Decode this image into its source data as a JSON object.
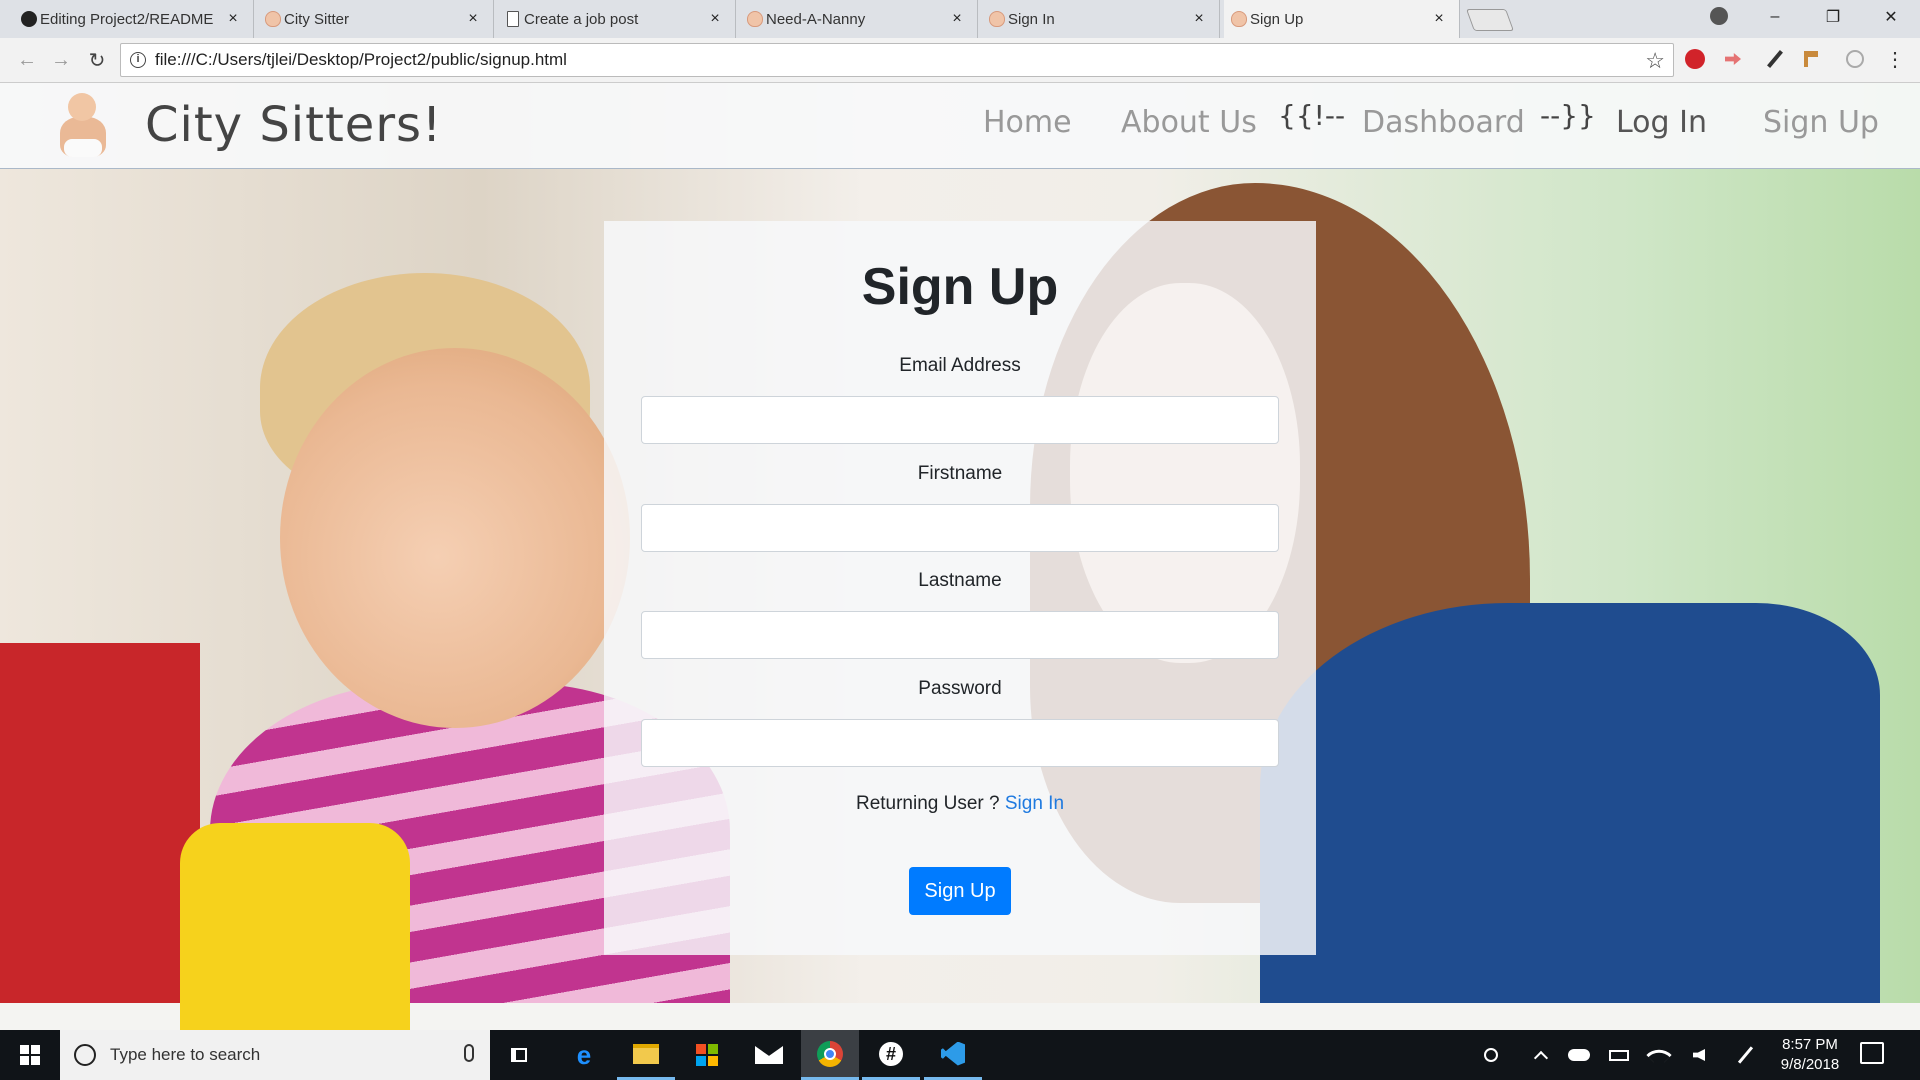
{
  "browser": {
    "tabs": [
      {
        "title": "Editing Project2/README",
        "favicon": "github-icon",
        "active": false
      },
      {
        "title": "City Sitter",
        "favicon": "baby-icon",
        "active": false
      },
      {
        "title": "Create a job post",
        "favicon": "document-icon",
        "active": false
      },
      {
        "title": "Need-A-Nanny",
        "favicon": "baby-icon",
        "active": false
      },
      {
        "title": "Sign In",
        "favicon": "baby-icon",
        "active": false
      },
      {
        "title": "Sign Up",
        "favicon": "baby-icon",
        "active": true
      }
    ],
    "tab_close_glyph": "×",
    "url": "file:///C:/Users/tjlei/Desktop/Project2/public/signup.html",
    "window_controls": {
      "minimize": "–",
      "maximize": "❐",
      "close": "✕"
    },
    "nav": {
      "back": "←",
      "forward": "→",
      "reload": "↻"
    },
    "star": "☆",
    "info": "i",
    "menu": "⋮"
  },
  "site_nav": {
    "brand": "City Sitters!",
    "links": {
      "home": "Home",
      "about": "About Us",
      "raw_open": "{{!--",
      "dashboard": "Dashboard",
      "raw_close": "--}}",
      "login": "Log In",
      "signup": "Sign Up"
    }
  },
  "form": {
    "title": "Sign Up",
    "fields": [
      {
        "label": "Email Address",
        "value": ""
      },
      {
        "label": "Firstname",
        "value": ""
      },
      {
        "label": "Lastname",
        "value": ""
      },
      {
        "label": "Password",
        "value": ""
      }
    ],
    "returning_text": "Returning User ?",
    "signin_link": "Sign In",
    "submit": "Sign Up"
  },
  "taskbar": {
    "search_placeholder": "Type here to search",
    "time": "8:57 PM",
    "date": "9/8/2018",
    "accent": "#76b9ed"
  },
  "colors": {
    "primary_button": "#007bff",
    "link": "#1f7ae0"
  }
}
